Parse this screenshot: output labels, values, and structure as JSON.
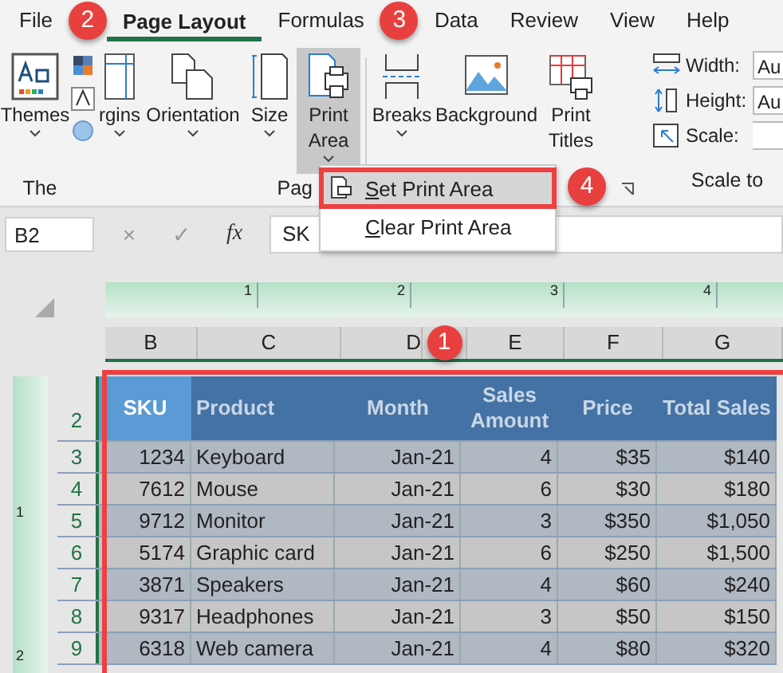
{
  "tabs": [
    {
      "label": "File",
      "selected": false
    },
    {
      "label": "Page Layout",
      "selected": true
    },
    {
      "label": "Formulas",
      "selected": false
    },
    {
      "label": "Data",
      "selected": false
    },
    {
      "label": "Review",
      "selected": false
    },
    {
      "label": "View",
      "selected": false
    },
    {
      "label": "Help",
      "selected": false
    }
  ],
  "ribbon": {
    "buttons": [
      {
        "lines": [
          "Themes"
        ],
        "dropdown": true,
        "selected": false
      },
      {
        "lines": [
          "rgins"
        ],
        "dropdown": true,
        "selected": false
      },
      {
        "lines": [
          "Orientation"
        ],
        "dropdown": true,
        "selected": false
      },
      {
        "lines": [
          "Size"
        ],
        "dropdown": true,
        "selected": false
      },
      {
        "lines": [
          "Print",
          "Area"
        ],
        "dropdown": true,
        "selected": true
      },
      {
        "lines": [
          "Breaks"
        ],
        "dropdown": true,
        "selected": false
      },
      {
        "lines": [
          "Background"
        ],
        "dropdown": false,
        "selected": false
      },
      {
        "lines": [
          "Print",
          "Titles"
        ],
        "dropdown": false,
        "selected": false
      }
    ],
    "group_labels": [
      "The",
      "Pag"
    ],
    "scale_fields": [
      {
        "label": "Width:",
        "value": "Au"
      },
      {
        "label": "Height:",
        "value": "Au"
      },
      {
        "label": "Scale:"
      }
    ],
    "scale_group_label": "Scale to"
  },
  "menu": [
    {
      "label": "Set Print Area",
      "selected": true
    },
    {
      "label": "Clear Print Area",
      "selected": false
    }
  ],
  "formula_bar": {
    "name_box": "B2",
    "cancel": "×",
    "enter": "✓",
    "fx": "fx",
    "content": "SK"
  },
  "ruler": [
    "1",
    "2",
    "3",
    "4"
  ],
  "vruler": [
    "1",
    "2"
  ],
  "columns": [
    "B",
    "C",
    "D",
    "E",
    "F",
    "G"
  ],
  "header_row": {
    "number": "2",
    "cells": [
      {
        "text": "SKU",
        "selected": true
      },
      {
        "text": "Product",
        "selected": false
      },
      {
        "text": "Month",
        "selected": false
      },
      {
        "text": "Sales Amount",
        "selected": false
      },
      {
        "text": "Price",
        "selected": false
      },
      {
        "text": "Total Sales",
        "selected": false
      }
    ]
  },
  "rows": [
    {
      "number": "3",
      "cells": [
        "1234",
        "Keyboard",
        "Jan-21",
        "4",
        "$35",
        "$140"
      ]
    },
    {
      "number": "4",
      "cells": [
        "7612",
        "Mouse",
        "Jan-21",
        "6",
        "$30",
        "$180"
      ]
    },
    {
      "number": "5",
      "cells": [
        "9712",
        "Monitor",
        "Jan-21",
        "3",
        "$350",
        "$1,050"
      ]
    },
    {
      "number": "6",
      "cells": [
        "5174",
        "Graphic card",
        "Jan-21",
        "6",
        "$250",
        "$1,500"
      ]
    },
    {
      "number": "7",
      "cells": [
        "3871",
        "Speakers",
        "Jan-21",
        "4",
        "$60",
        "$240"
      ]
    },
    {
      "number": "8",
      "cells": [
        "9317",
        "Headphones",
        "Jan-21",
        "3",
        "$50",
        "$150"
      ]
    },
    {
      "number": "9",
      "cells": [
        "6318",
        "Web camera",
        "Jan-21",
        "4",
        "$80",
        "$320"
      ]
    }
  ],
  "badges": [
    "1",
    "2",
    "3",
    "4"
  ]
}
